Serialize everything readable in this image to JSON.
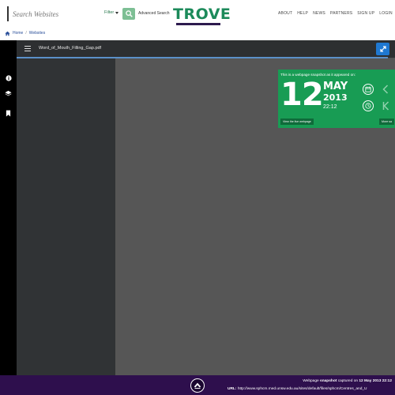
{
  "header": {
    "search_placeholder": "Search Websites",
    "filter_label": "Filter",
    "advanced_search": "Advanced Search",
    "logo_text": "TROVE",
    "nav": [
      "ABOUT",
      "HELP",
      "NEWS",
      "PARTNERS",
      "SIGN UP",
      "LOGIN"
    ]
  },
  "breadcrumb": {
    "home": "Home",
    "separator": "/",
    "current": "Websites"
  },
  "viewer": {
    "file_name": "Word_of_Mouth_Filling_Gap.pdf"
  },
  "snapshot": {
    "title": "This is a webpage snapshot as it appeared on:",
    "day": "12",
    "month": "MAY",
    "year": "2013",
    "time": "22:12",
    "live_button": "View the live webpage",
    "more_button": "More sa"
  },
  "footer": {
    "prefix": "Webpage",
    "keyword": "snapshot",
    "captured": "captured on",
    "date": "12 May 2013 22:12",
    "url_label": "URL:",
    "url": "http://www.sphcm.med.unsw.edu.au/sites/default/files/sphcm/Centres_and_U"
  },
  "colors": {
    "brand_green": "#189c54",
    "footer_purple": "#2e0f4d",
    "accent_blue": "#1f78d1"
  }
}
